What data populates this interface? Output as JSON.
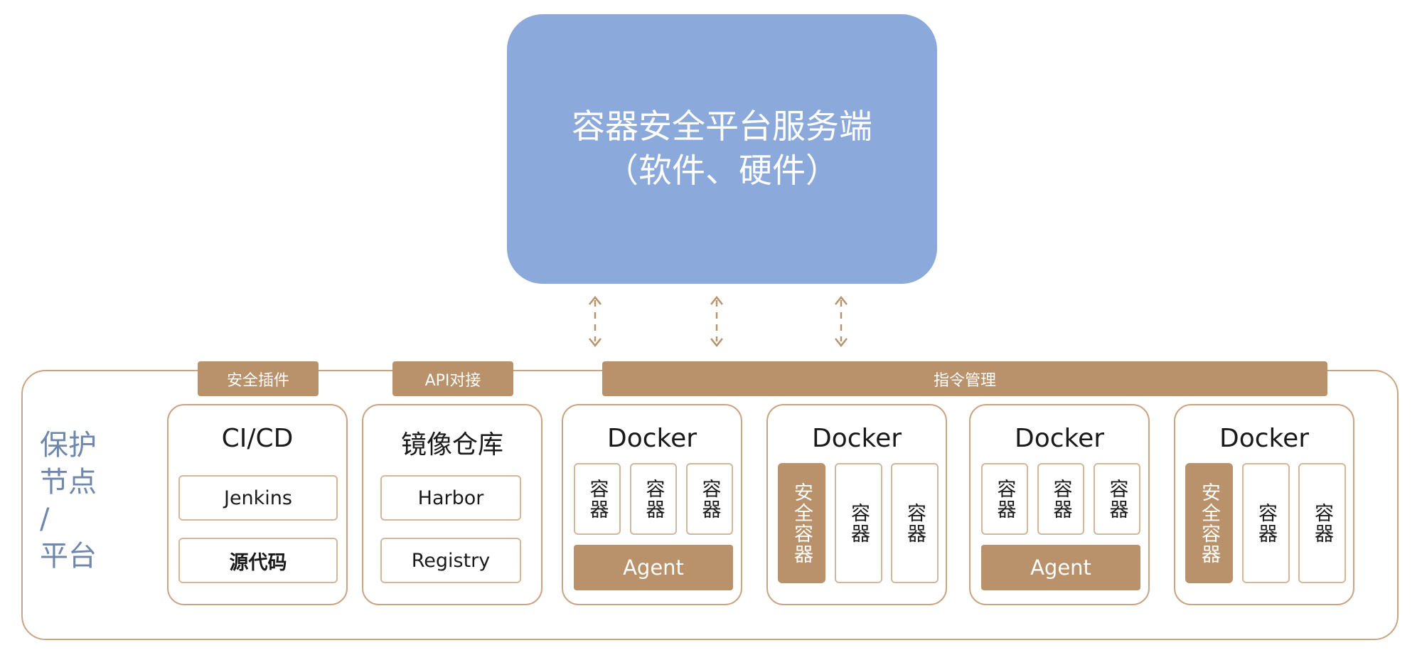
{
  "server": {
    "line1": "容器安全平台服务端",
    "line2": "（软件、硬件）"
  },
  "side_label": {
    "line1": "保护",
    "line2": "节点",
    "line3": "/",
    "line4": "平台"
  },
  "tabs": {
    "security_plugin": "安全插件",
    "api_integration": "API对接",
    "command_management": "指令管理"
  },
  "cicd": {
    "title": "CI/CD",
    "items": [
      "Jenkins",
      "源代码"
    ]
  },
  "registry": {
    "title": "镜像仓库",
    "items": [
      "Harbor",
      "Registry"
    ]
  },
  "docker_nodes": [
    {
      "title": "Docker",
      "containers": [
        "容器",
        "容器",
        "容器"
      ],
      "agent": "Agent"
    },
    {
      "title": "Docker",
      "security_container": "安全容器",
      "containers": [
        "容器",
        "容器"
      ]
    },
    {
      "title": "Docker",
      "containers": [
        "容器",
        "容器",
        "容器"
      ],
      "agent": "Agent"
    },
    {
      "title": "Docker",
      "security_container": "安全容器",
      "containers": [
        "容器",
        "容器"
      ]
    }
  ],
  "colors": {
    "server_fill": "#8ca9dc",
    "accent": "#b9916a",
    "border": "#c9a585",
    "side_label": "#6f87ad"
  }
}
